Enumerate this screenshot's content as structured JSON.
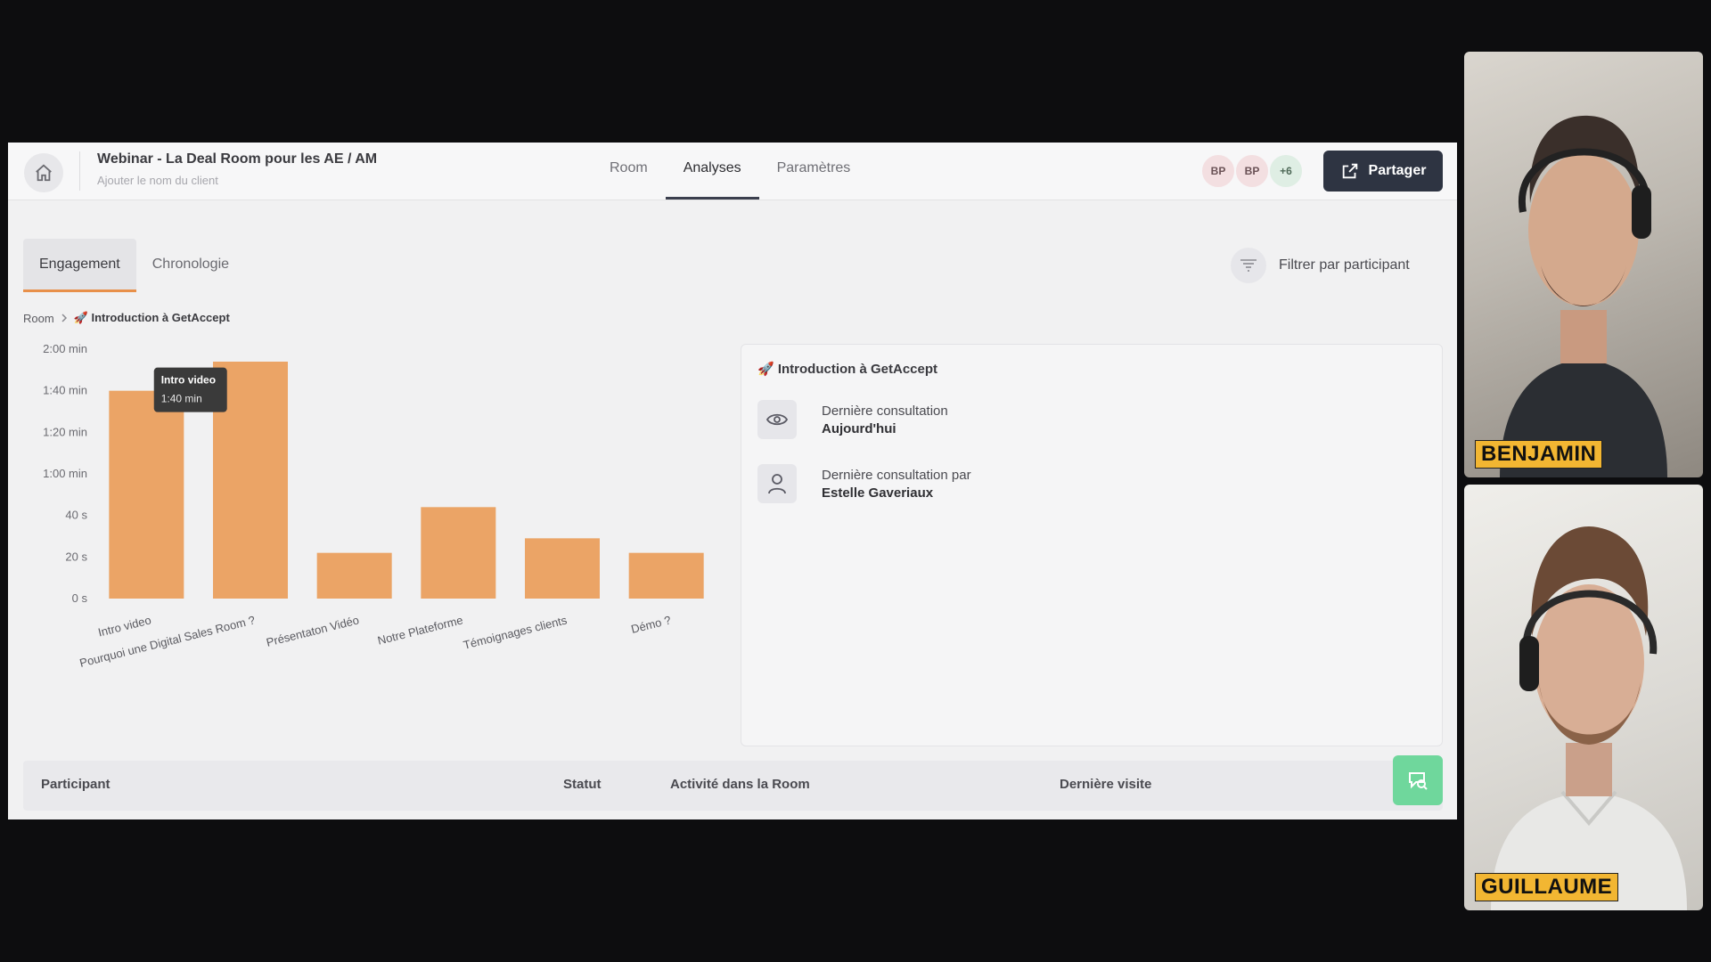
{
  "header": {
    "title": "Webinar - La Deal Room pour les AE / AM",
    "subtitle": "Ajouter le nom du client",
    "tabs": [
      {
        "label": "Room"
      },
      {
        "label": "Analyses"
      },
      {
        "label": "Paramètres"
      }
    ],
    "active_tab": "Analyses",
    "avatars": [
      "BP",
      "BP",
      "+6"
    ],
    "share_label": "Partager"
  },
  "subtabs": [
    {
      "label": "Engagement"
    },
    {
      "label": "Chronologie"
    }
  ],
  "filter_label": "Filtrer par participant",
  "breadcrumb": {
    "root": "Room",
    "current": "🚀 Introduction à GetAccept"
  },
  "chart_data": {
    "type": "bar",
    "categories": [
      "Intro video",
      "Pourquoi une Digital Sales Room ?",
      "Présentaton Vidéo",
      "Notre Plateforme",
      "Témoignages clients",
      "Démo ?"
    ],
    "values": [
      100,
      114,
      22,
      44,
      29,
      22
    ],
    "y_ticks": [
      {
        "value": 0,
        "label": "0 s"
      },
      {
        "value": 20,
        "label": "20 s"
      },
      {
        "value": 40,
        "label": "40 s"
      },
      {
        "value": 60,
        "label": "1:00 min"
      },
      {
        "value": 80,
        "label": "1:20 min"
      },
      {
        "value": 100,
        "label": "1:40 min"
      },
      {
        "value": 120,
        "label": "2:00 min"
      }
    ],
    "ylim": [
      0,
      120
    ],
    "bar_color": "#eba466",
    "tooltip": {
      "category_index": 0,
      "title": "Intro video",
      "value": "1:40 min"
    }
  },
  "card": {
    "title": "🚀 Introduction à GetAccept",
    "last_view_label": "Dernière consultation",
    "last_view_value": "Aujourd'hui",
    "last_view_by_label": "Dernière consultation par",
    "last_view_by_value": "Estelle Gaveriaux"
  },
  "table": {
    "columns": [
      "Participant",
      "Statut",
      "Activité dans la Room",
      "Dernière visite"
    ]
  },
  "participants": [
    {
      "name": "BENJAMIN"
    },
    {
      "name": "GUILLAUME"
    }
  ],
  "colors": {
    "accent": "#e8904a",
    "share_button": "#2e3442",
    "chat_button": "#6fd79c"
  }
}
